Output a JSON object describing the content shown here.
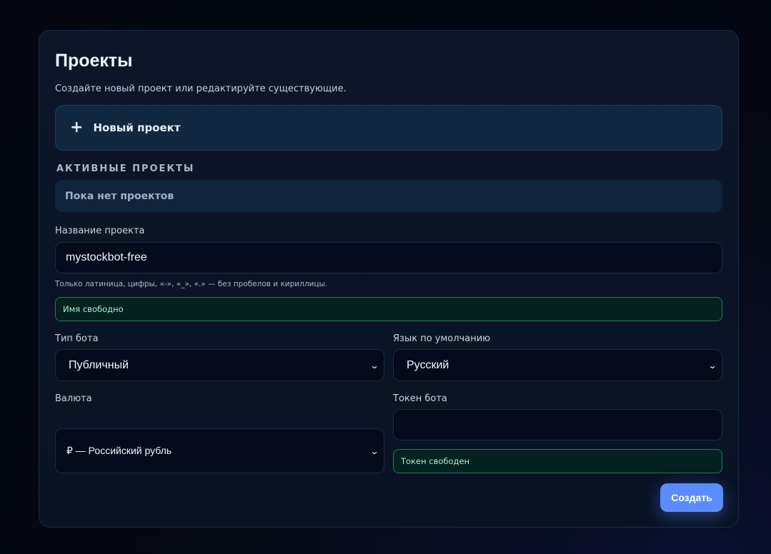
{
  "page": {
    "title": "Проекты",
    "subtitle": "Создайте новый проект или редактируйте существующие."
  },
  "new_project": {
    "icon": "plus-icon",
    "plus_glyph": "+",
    "label": "Новый проект"
  },
  "active_projects": {
    "heading": "АКТИВНЫЕ ПРОЕКТЫ",
    "empty_text": "Пока нет проектов"
  },
  "form": {
    "project_name": {
      "label": "Название проекта",
      "value": "mystockbot-free",
      "hint": "Только латиница, цифры, «-», «_», «.» — без пробелов и кириллицы.",
      "status": "Имя свободно"
    },
    "bot_type": {
      "label": "Тип бота",
      "selected": "Публичный"
    },
    "language": {
      "label": "Язык по умолчанию",
      "selected": "Русский"
    },
    "currency": {
      "label": "Валюта",
      "selected": "₽ — Российский рубль"
    },
    "bot_token": {
      "label": "Токен бота",
      "value": "",
      "status": "Токен свободен"
    },
    "submit_label": "Создать"
  },
  "colors": {
    "accent": "#5b8cff",
    "success_border": "#1f7a55",
    "success_text": "#a9f0c8",
    "card_bg": "#0c1628"
  }
}
